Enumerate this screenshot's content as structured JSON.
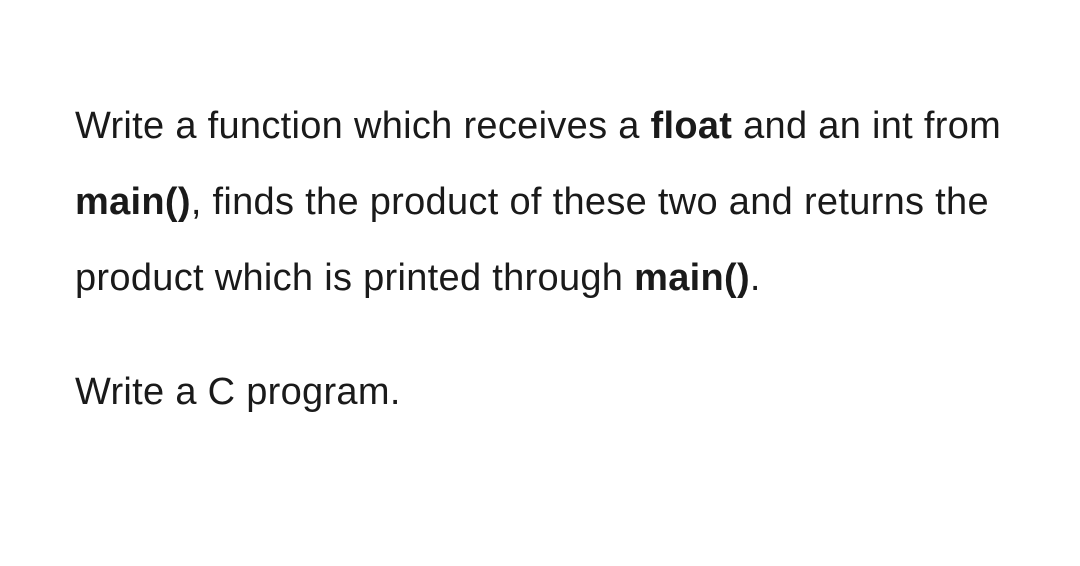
{
  "p1": {
    "t1": "Write a function which receives a ",
    "b1": "float",
    "t2": " and an int from ",
    "b2": "main()",
    "t3": ", finds the product of these two and returns the product which is printed through ",
    "b3": "main()",
    "t4": "."
  },
  "p2": "Write a C program."
}
